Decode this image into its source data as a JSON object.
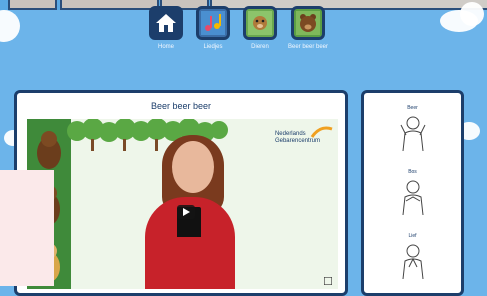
{
  "nav": {
    "items": [
      {
        "label": "Home"
      },
      {
        "label": "Liedjes"
      },
      {
        "label": "Dieren"
      },
      {
        "label": "Beer beer beer"
      }
    ]
  },
  "video": {
    "title": "Beer beer beer",
    "logo_line1": "Nederlands",
    "logo_line2": "Gebarencentrum"
  },
  "signs": [
    {
      "label": "Beer"
    },
    {
      "label": "Bos"
    },
    {
      "label": "Lief"
    }
  ],
  "colors": {
    "background": "#6cb4ea",
    "accent": "#1c3e6b",
    "shirt": "#c7222a"
  }
}
